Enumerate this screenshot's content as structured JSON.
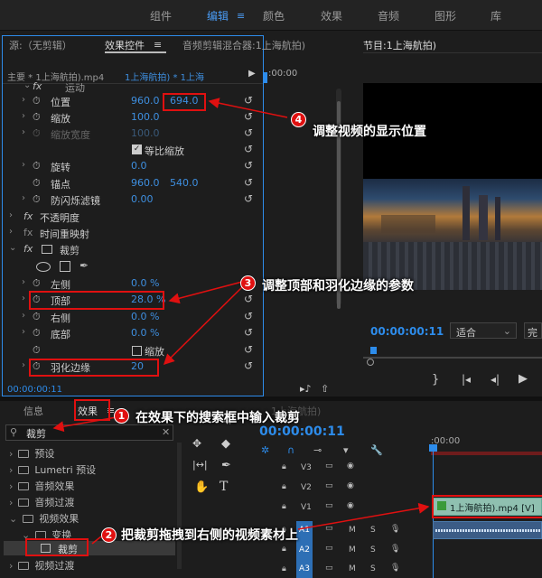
{
  "workspaces": [
    {
      "label": "组件",
      "active": false
    },
    {
      "label": "编辑",
      "active": true
    },
    {
      "label": "颜色",
      "active": false
    },
    {
      "label": "效果",
      "active": false
    },
    {
      "label": "音频",
      "active": false
    },
    {
      "label": "图形",
      "active": false
    },
    {
      "label": "库",
      "active": false
    }
  ],
  "source_tab": "源:（无剪辑）",
  "effect_controls_tab": "效果控件",
  "audio_mixer_tab": "音频剪辑混合器:1上海航拍)",
  "program_tab": "节目:1上海航拍)",
  "clip_header": {
    "master": "主要 * 1上海航拍).mp4",
    "sequence": "1上海航拍) * 1上海",
    "ruler_time": ":00:00"
  },
  "motion": {
    "label": "运动",
    "position_label": "位置",
    "position_x": "960.0",
    "position_y": "694.0",
    "scale_label": "缩放",
    "scale_val": "100.0",
    "scale_width_label": "缩放宽度",
    "scale_width_val": "100.0",
    "uniform_scale_label": "等比缩放",
    "rotation_label": "旋转",
    "rotation_val": "0.0",
    "anchor_label": "锚点",
    "anchor_x": "960.0",
    "anchor_y": "540.0",
    "antiflicker_label": "防闪烁滤镜",
    "antiflicker_val": "0.00"
  },
  "opacity_label": "不透明度",
  "time_remap_label": "时间重映射",
  "crop": {
    "label": "裁剪",
    "left_label": "左侧",
    "left_val": "0.0 %",
    "top_label": "顶部",
    "top_val": "28.0 %",
    "right_label": "右侧",
    "right_val": "0.0 %",
    "bottom_label": "底部",
    "bottom_val": "0.0 %",
    "zoom_label": "缩放",
    "feather_label": "羽化边缘",
    "feather_val": "20"
  },
  "ec_timecode": "00:00:00:11",
  "program": {
    "timecode": "00:00:00:11",
    "fit": "适合",
    "quality": "完"
  },
  "bottom_tabs": {
    "info": "信息",
    "effects": "效果"
  },
  "search_value": "裁剪",
  "effects_tree": [
    {
      "label": "预设",
      "level": 0
    },
    {
      "label": "Lumetri 预设",
      "level": 0
    },
    {
      "label": "音频效果",
      "level": 0
    },
    {
      "label": "音频过渡",
      "level": 0
    },
    {
      "label": "视频效果",
      "level": 0
    },
    {
      "label": "变换",
      "level": 1
    },
    {
      "label": "裁剪",
      "level": 2
    },
    {
      "label": "视频过渡",
      "level": 0
    }
  ],
  "timeline": {
    "tab": "1上海航拍)",
    "timecode": "00:00:00:11",
    "ruler": ":00:00",
    "tracks": [
      "V3",
      "V2",
      "V1",
      "A1",
      "A2",
      "A3"
    ],
    "clip_label": "1上海航拍).mp4 [V]",
    "track_m": "M",
    "track_s": "S"
  },
  "annotations": [
    {
      "num": "1",
      "text": "在效果下的搜索框中输入裁剪"
    },
    {
      "num": "2",
      "text": "把裁剪拖拽到右侧的视频素材上"
    },
    {
      "num": "3",
      "text": "调整顶部和羽化边缘的参数"
    },
    {
      "num": "4",
      "text": "调整视频的显示位置"
    }
  ],
  "colors": {
    "accent": "#2d8ceb",
    "annotation_red": "#e01010",
    "panel_bg": "#1d1d1d"
  }
}
